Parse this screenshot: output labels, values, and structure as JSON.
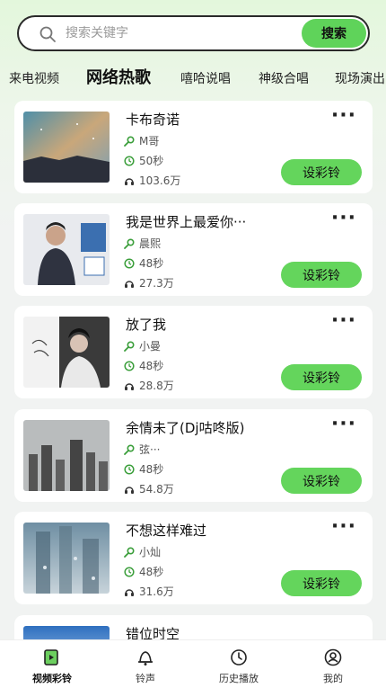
{
  "search": {
    "placeholder": "搜索关键字",
    "button_label": "搜索"
  },
  "tabs": [
    {
      "label": "来电视频",
      "active": false
    },
    {
      "label": "网络热歌",
      "active": true
    },
    {
      "label": "嘻哈说唱",
      "active": false
    },
    {
      "label": "神级合唱",
      "active": false
    },
    {
      "label": "现场演出",
      "active": false
    }
  ],
  "songs": [
    {
      "title": "卡布奇诺",
      "artist": "M哥",
      "duration": "50秒",
      "plays": "103.6万",
      "button": "设彩铃",
      "more": "···"
    },
    {
      "title": "我是世界上最爱你···",
      "artist": "晨熙",
      "duration": "48秒",
      "plays": "27.3万",
      "button": "设彩铃",
      "more": "···"
    },
    {
      "title": "放了我",
      "artist": "小曼",
      "duration": "48秒",
      "plays": "28.8万",
      "button": "设彩铃",
      "more": "···"
    },
    {
      "title": "余情未了(Dj咕咚版)",
      "artist": "弦···",
      "duration": "48秒",
      "plays": "54.8万",
      "button": "设彩铃",
      "more": "···"
    },
    {
      "title": "不想这样难过",
      "artist": "小灿",
      "duration": "48秒",
      "plays": "31.6万",
      "button": "设彩铃",
      "more": "···"
    },
    {
      "title": "错位时空"
    }
  ],
  "bottom_nav": [
    {
      "label": "视频彩铃",
      "icon": "video-ringtone-icon",
      "active": true
    },
    {
      "label": "铃声",
      "icon": "bell-icon",
      "active": false
    },
    {
      "label": "历史播放",
      "icon": "clock-icon",
      "active": false
    },
    {
      "label": "我的",
      "icon": "user-icon",
      "active": false
    }
  ],
  "colors": {
    "accent": "#64d55c",
    "background_top": "#e3f7dc",
    "background": "#f1f3f2"
  }
}
